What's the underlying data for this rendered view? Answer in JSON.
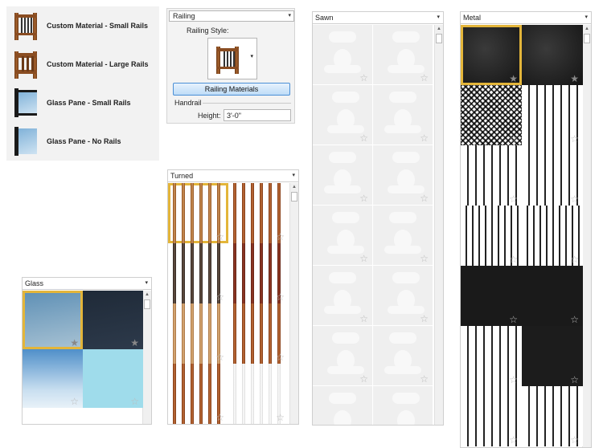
{
  "style_list": {
    "items": [
      {
        "label": "Custom Material - Small Rails",
        "thumb": "wood-small-rails"
      },
      {
        "label": "Custom Material - Large Rails",
        "thumb": "wood-large-rails"
      },
      {
        "label": "Glass Pane - Small Rails",
        "thumb": "glass-small-rails"
      },
      {
        "label": "Glass Pane - No Rails",
        "thumb": "glass-no-rails"
      }
    ]
  },
  "properties": {
    "category_value": "Railing",
    "railing_style_label": "Railing Style:",
    "materials_button": "Railing Materials",
    "handrail_label": "Handrail",
    "height_label": "Height:",
    "height_value": "3'-0\""
  },
  "panels": {
    "sawn": {
      "title": "Sawn",
      "arrow": "▾"
    },
    "metal": {
      "title": "Metal",
      "arrow": "▾"
    },
    "turned": {
      "title": "Turned",
      "arrow": "▾"
    },
    "glass": {
      "title": "Glass",
      "arrow": "▾"
    }
  },
  "icons": {
    "star": "☆",
    "star_filled": "★",
    "dropdown": "▾",
    "scroll_up": "▲"
  },
  "colors": {
    "selection": "#e3b53a",
    "button_border": "#4a8fd6"
  }
}
